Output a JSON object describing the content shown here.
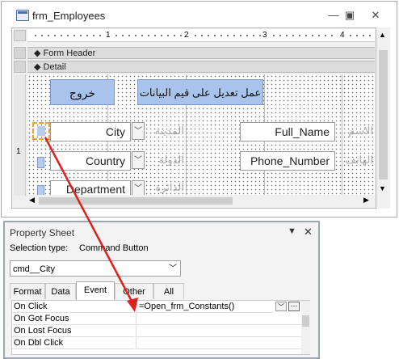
{
  "window": {
    "title": "frm_Employees",
    "min": "—",
    "restore": "▣",
    "close": "✕"
  },
  "ruler": {
    "n1": "1",
    "n2": "2",
    "n3": "3",
    "n4": "4"
  },
  "sections": {
    "form_header": "Form Header",
    "detail": "Detail"
  },
  "form": {
    "exit_button": "خروج",
    "edit_button": "عمل تعديل على قيم البيانات",
    "city_field": "City",
    "city_label": "المدينة",
    "fullname_field": "Full_Name",
    "fullname_label": "الاسم",
    "country_field": "Country",
    "country_label": "الدولة",
    "phone_field": "Phone_Number",
    "phone_label": "الهاتف",
    "department_field": "Department",
    "department_label": "الدائرة"
  },
  "property_sheet": {
    "title": "Property Sheet",
    "selection_label": "Selection type:",
    "selection_value": "Command Button",
    "object": "cmd__City",
    "tabs": [
      "Format",
      "Data",
      "Event",
      "Other",
      "All"
    ],
    "active_tab": "Event",
    "rows": [
      {
        "name": "On Click",
        "value": "=Open_frm_Constants()"
      },
      {
        "name": "On Got Focus",
        "value": ""
      },
      {
        "name": "On Lost Focus",
        "value": ""
      },
      {
        "name": "On Dbl Click",
        "value": ""
      }
    ],
    "pin": "▼",
    "close": "✕"
  },
  "colors": {
    "arrow": "#e02020",
    "button_fill": "#a9c4ec",
    "selection": "#f0a030"
  }
}
